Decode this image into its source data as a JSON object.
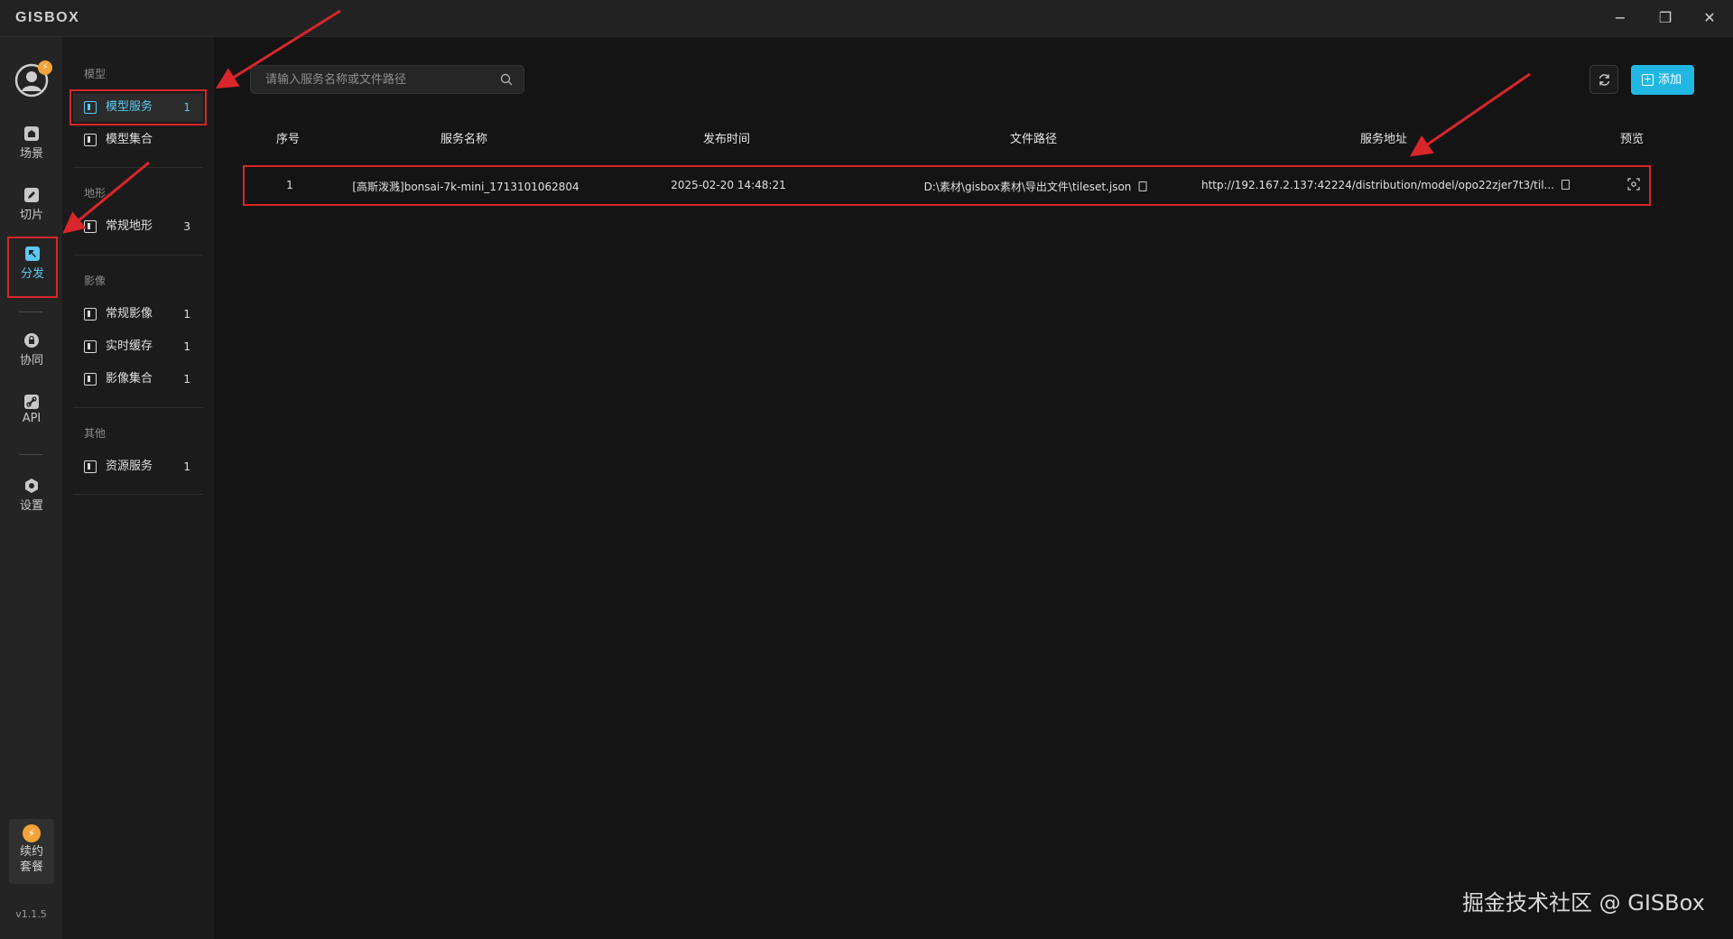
{
  "app": {
    "logo": "GISBOX"
  },
  "window_controls": {
    "minimize": "−",
    "restore": "❐",
    "close": "✕"
  },
  "rail": {
    "avatar_badge": "⚡",
    "items": [
      {
        "label": "场景",
        "icon": "home-icon"
      },
      {
        "label": "切片",
        "icon": "edit-icon"
      },
      {
        "label": "分发",
        "icon": "distribute-icon"
      },
      {
        "label": "协同",
        "icon": "lock-icon"
      },
      {
        "label": "API",
        "icon": "link-icon"
      },
      {
        "label": "设置",
        "icon": "gear-icon"
      }
    ],
    "renew_line1": "续约",
    "renew_line2": "套餐",
    "version": "v1.1.5"
  },
  "subnav": {
    "groups": [
      {
        "title": "模型",
        "items": [
          {
            "label": "模型服务",
            "count": "1"
          },
          {
            "label": "模型集合",
            "count": ""
          }
        ]
      },
      {
        "title": "地形",
        "items": [
          {
            "label": "常规地形",
            "count": "3"
          }
        ]
      },
      {
        "title": "影像",
        "items": [
          {
            "label": "常规影像",
            "count": "1"
          },
          {
            "label": "实时缓存",
            "count": "1"
          },
          {
            "label": "影像集合",
            "count": "1"
          }
        ]
      },
      {
        "title": "其他",
        "items": [
          {
            "label": "资源服务",
            "count": "1"
          }
        ]
      }
    ]
  },
  "toolbar": {
    "search_placeholder": "请输入服务名称或文件路径",
    "add_label": "添加"
  },
  "table": {
    "headers": [
      "序号",
      "服务名称",
      "发布时间",
      "文件路径",
      "服务地址",
      "预览"
    ],
    "rows": [
      {
        "index": "1",
        "name": "[高斯泼溅]bonsai-7k-mini_1713101062804",
        "time": "2025-02-20 14:48:21",
        "path": "D:\\素材\\gisbox素材\\导出文件\\tileset.json",
        "url": "http://192.167.2.137:42224/distribution/model/opo22zjer7t3/til..."
      }
    ]
  },
  "colors": {
    "accent": "#20b7e2",
    "highlight": "#d8262a",
    "background": "#141414"
  },
  "watermark": "掘金技术社区 @ GISBox"
}
